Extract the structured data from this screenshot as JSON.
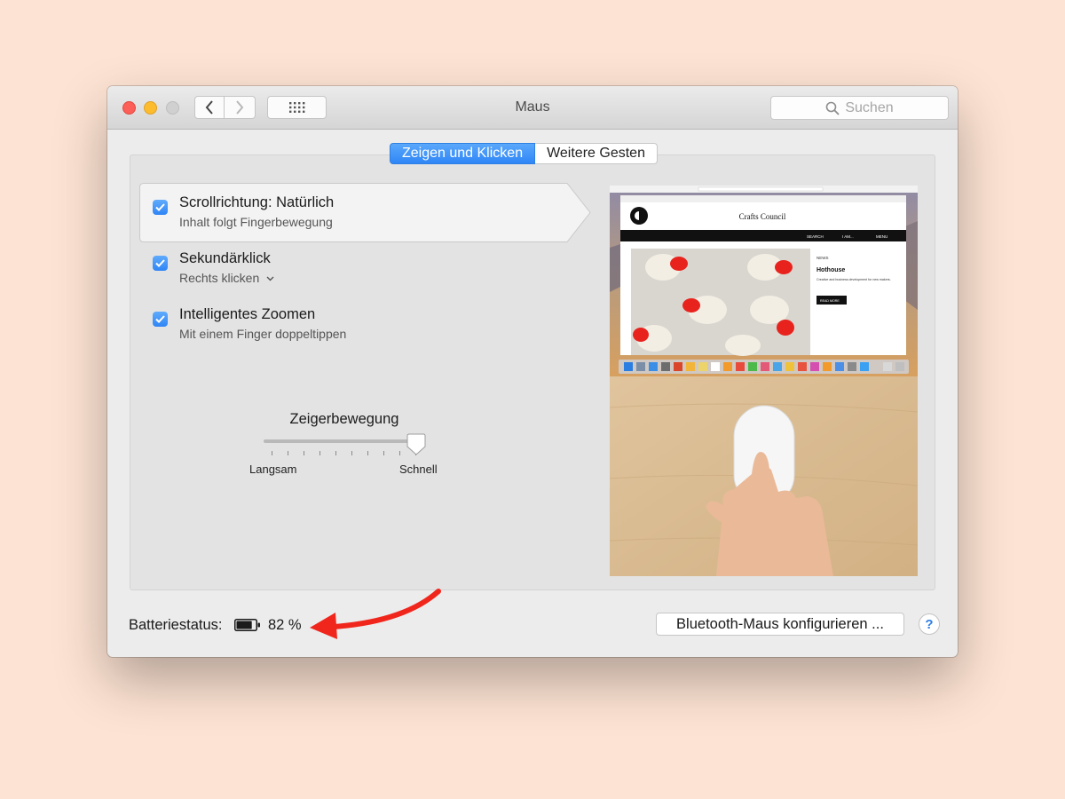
{
  "window": {
    "title": "Maus",
    "search_placeholder": "Suchen"
  },
  "tabs": [
    {
      "label": "Zeigen und Klicken",
      "active": true
    },
    {
      "label": "Weitere Gesten",
      "active": false
    }
  ],
  "options": [
    {
      "title": "Scrollrichtung: Natürlich",
      "subtitle": "Inhalt folgt Fingerbewegung",
      "checked": true,
      "selected": true
    },
    {
      "title": "Sekundärklick",
      "subtitle": "Rechts klicken",
      "checked": true,
      "selected": false,
      "has_dropdown": true
    },
    {
      "title": "Intelligentes Zoomen",
      "subtitle": "Mit einem Finger doppeltippen",
      "checked": true,
      "selected": false
    }
  ],
  "slider": {
    "label": "Zeigerbewegung",
    "min_label": "Langsam",
    "max_label": "Schnell",
    "value_fraction": 1.0
  },
  "preview": {
    "site_title": "Crafts Council",
    "nav": {
      "search": "SEARCH",
      "iam": "I AM...",
      "menu": "MENU"
    },
    "news_tag": "NEWS",
    "article_title": "Hothouse",
    "article_text": "Creative and business development for new makers.",
    "read_more": "READ MORE"
  },
  "footer": {
    "battery_label": "Batteriestatus:",
    "battery_percent": "82 %",
    "battery_level": 0.82,
    "bluetooth_button": "Bluetooth-Maus konfigurieren ...",
    "help_label": "?"
  },
  "colors": {
    "background": "#fde3d3",
    "accent": "#2f86f6",
    "annotation_arrow": "#f0261c"
  }
}
